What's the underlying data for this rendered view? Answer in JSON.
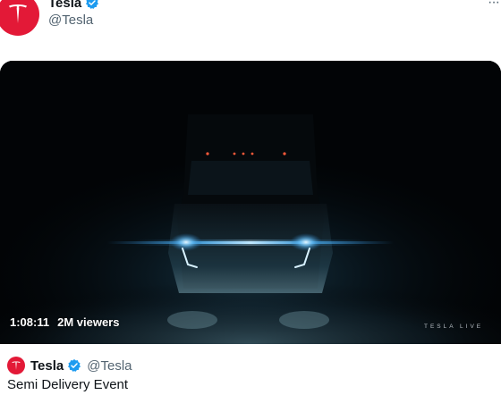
{
  "account": {
    "name": "Tesla",
    "handle": "@Tesla",
    "brand_color": "#e31937",
    "verified_color": "#1d9bf0"
  },
  "icons": {
    "avatar": "tesla-logo-icon",
    "verified": "verified-badge-icon",
    "more": "more-options-icon"
  },
  "header": {
    "more_label": "···"
  },
  "media": {
    "duration": "1:08:11",
    "viewers": "2M viewers",
    "watermark": "TESLA LIVE"
  },
  "card": {
    "name": "Tesla",
    "handle": "@Tesla",
    "title": "Semi Delivery Event"
  }
}
